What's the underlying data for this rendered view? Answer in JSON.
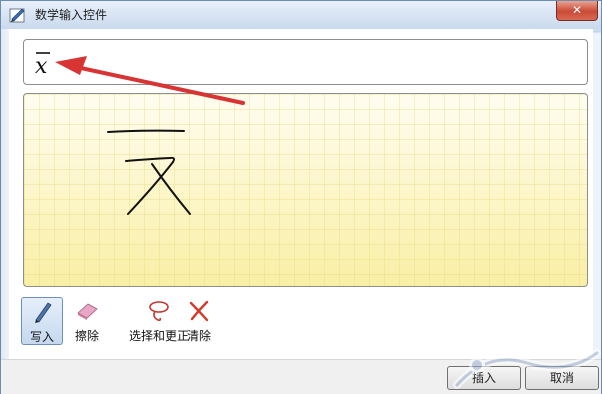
{
  "window": {
    "title": "数学输入控件",
    "close_label": "✕"
  },
  "preview": {
    "expression": "x̄",
    "base": "x"
  },
  "toolbar": {
    "tools": [
      {
        "label": "写入",
        "icon": "pen-icon",
        "active": true
      },
      {
        "label": "擦除",
        "icon": "eraser-icon",
        "active": false
      },
      {
        "label": "选择和更正",
        "icon": "lasso-icon",
        "active": false
      },
      {
        "label": "清除",
        "icon": "clear-x-icon",
        "active": false
      }
    ]
  },
  "footer": {
    "insert_label": "插入",
    "cancel_label": "取消"
  },
  "colors": {
    "arrow": "#d93434",
    "ink": "#111111",
    "pad": "#fbf3b8",
    "accent": "#c94a36"
  }
}
